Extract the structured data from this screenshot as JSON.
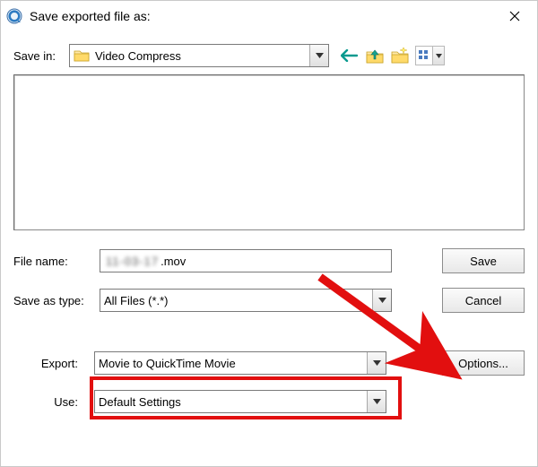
{
  "window": {
    "title": "Save exported file as:"
  },
  "savein": {
    "label": "Save in:",
    "value": "Video Compress"
  },
  "nav": {
    "back": "back",
    "up": "up-one-level",
    "new_folder": "create-new-folder",
    "view": "view-menu"
  },
  "filename": {
    "label": "File name:",
    "value_blurred": "11-03-17",
    "value_suffix": ".mov"
  },
  "saveastype": {
    "label": "Save as type:",
    "value": "All Files (*.*)"
  },
  "buttons": {
    "save": "Save",
    "cancel": "Cancel",
    "options": "Options..."
  },
  "export": {
    "label": "Export:",
    "value": "Movie to QuickTime Movie"
  },
  "use": {
    "label": "Use:",
    "value": "Default Settings"
  },
  "annotation": {
    "highlight_target": "export-combo",
    "arrow_target": "options-button",
    "color": "#e20f0f"
  }
}
